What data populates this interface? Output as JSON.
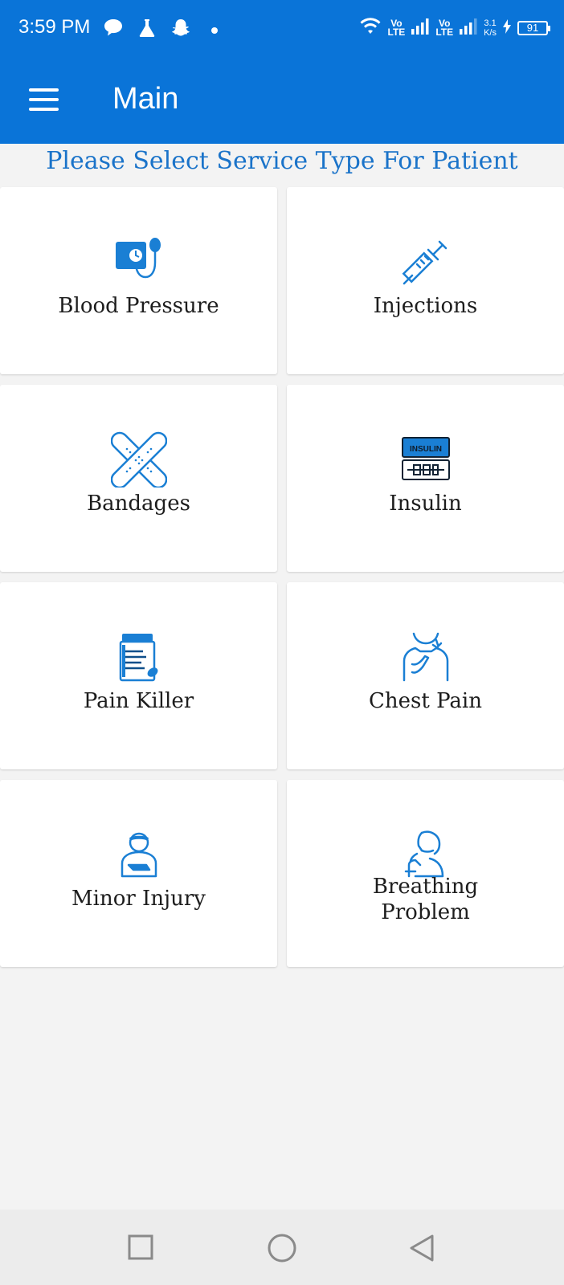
{
  "status_bar": {
    "time": "3:59 PM",
    "network_1_top": "Vo",
    "network_1_bottom": "LTE",
    "network_2_top": "Vo",
    "network_2_bottom": "LTE",
    "speed_value": "3.1",
    "speed_unit": "K/s",
    "battery": "91"
  },
  "toolbar": {
    "title": "Main"
  },
  "main": {
    "prompt": "Please Select Service Type For Patient",
    "services": [
      {
        "label": "Blood Pressure",
        "icon": "blood-pressure-icon"
      },
      {
        "label": "Injections",
        "icon": "syringe-icon"
      },
      {
        "label": "Bandages",
        "icon": "bandage-icon"
      },
      {
        "label": "Insulin",
        "icon": "insulin-icon"
      },
      {
        "label": "Pain Killer",
        "icon": "pill-bottle-icon"
      },
      {
        "label": "Chest Pain",
        "icon": "chest-pain-icon"
      },
      {
        "label": "Minor Injury",
        "icon": "injured-person-icon"
      },
      {
        "label": "Breathing Problem",
        "icon": "breathing-icon"
      }
    ],
    "insulin_icon_text": "INSULIN"
  },
  "colors": {
    "primary": "#0a74d8",
    "prompt_text": "#1a73c9",
    "icon_blue": "#1a7fd4"
  }
}
